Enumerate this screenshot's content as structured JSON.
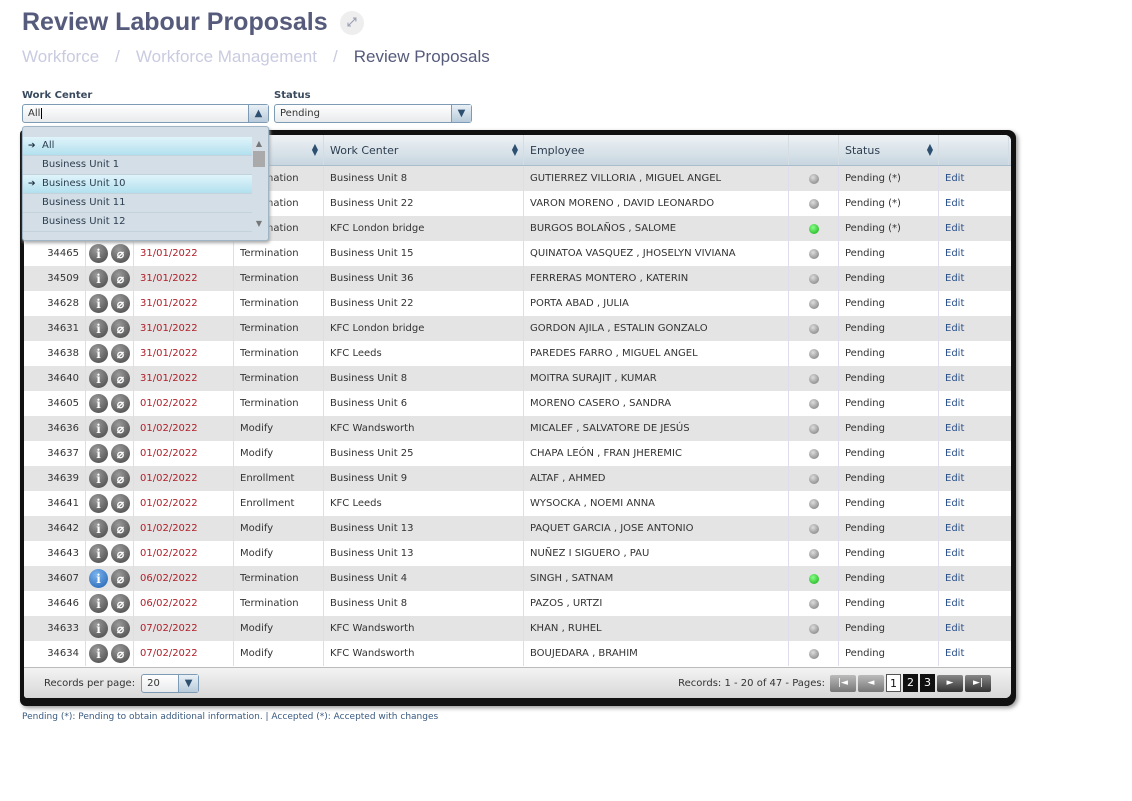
{
  "header": {
    "title": "Review Labour Proposals",
    "breadcrumb": [
      "Workforce",
      "Workforce Management",
      "Review Proposals"
    ]
  },
  "filters": {
    "work_center_label": "Work Center",
    "work_center_value": "All",
    "status_label": "Status",
    "status_value": "Pending"
  },
  "dropdown": {
    "options": [
      {
        "label": "All",
        "marker": true
      },
      {
        "label": "Business Unit 1",
        "marker": false
      },
      {
        "label": "Business Unit 10",
        "marker": true
      },
      {
        "label": "Business Unit 11",
        "marker": false
      },
      {
        "label": "Business Unit 12",
        "marker": false
      }
    ]
  },
  "table": {
    "columns": [
      "",
      "",
      "",
      "",
      "Work Center",
      "Employee",
      "",
      "Status",
      ""
    ],
    "rows": [
      {
        "id": "",
        "info": "gray",
        "date": "",
        "type": "Termination",
        "wc": "Business Unit 8",
        "emp": "GUTIERREZ VILLORIA , MIGUEL ANGEL",
        "dot": "gray",
        "status": "Pending (*)",
        "action": "Edit"
      },
      {
        "id": "",
        "info": "gray",
        "date": "",
        "type": "Termination",
        "wc": "Business Unit 22",
        "emp": "VARON MORENO , DAVID LEONARDO",
        "dot": "gray",
        "status": "Pending (*)",
        "action": "Edit"
      },
      {
        "id": "",
        "info": "gray",
        "date": "",
        "type": "Termination",
        "wc": "KFC London bridge",
        "emp": "BURGOS BOLAÑOS , SALOME",
        "dot": "green",
        "status": "Pending (*)",
        "action": "Edit"
      },
      {
        "id": "34465",
        "info": "gray",
        "date": "31/01/2022",
        "type": "Termination",
        "wc": "Business Unit 15",
        "emp": "QUINATOA VASQUEZ , JHOSELYN VIVIANA",
        "dot": "gray",
        "status": "Pending",
        "action": "Edit"
      },
      {
        "id": "34509",
        "info": "gray",
        "date": "31/01/2022",
        "type": "Termination",
        "wc": "Business Unit 36",
        "emp": "FERRERAS MONTERO , KATERIN",
        "dot": "gray",
        "status": "Pending",
        "action": "Edit"
      },
      {
        "id": "34628",
        "info": "gray",
        "date": "31/01/2022",
        "type": "Termination",
        "wc": "Business Unit 22",
        "emp": "PORTA ABAD , JULIA",
        "dot": "gray",
        "status": "Pending",
        "action": "Edit"
      },
      {
        "id": "34631",
        "info": "gray",
        "date": "31/01/2022",
        "type": "Termination",
        "wc": "KFC London bridge",
        "emp": "GORDON AJILA , ESTALIN GONZALO",
        "dot": "gray",
        "status": "Pending",
        "action": "Edit"
      },
      {
        "id": "34638",
        "info": "gray",
        "date": "31/01/2022",
        "type": "Termination",
        "wc": "KFC Leeds",
        "emp": "PAREDES FARRO , MIGUEL ANGEL",
        "dot": "gray",
        "status": "Pending",
        "action": "Edit"
      },
      {
        "id": "34640",
        "info": "gray",
        "date": "31/01/2022",
        "type": "Termination",
        "wc": "Business Unit 8",
        "emp": "MOITRA SURAJIT , KUMAR",
        "dot": "gray",
        "status": "Pending",
        "action": "Edit"
      },
      {
        "id": "34605",
        "info": "gray",
        "date": "01/02/2022",
        "type": "Termination",
        "wc": "Business Unit 6",
        "emp": "MORENO CASERO , SANDRA",
        "dot": "gray",
        "status": "Pending",
        "action": "Edit"
      },
      {
        "id": "34636",
        "info": "gray",
        "date": "01/02/2022",
        "type": "Modify",
        "wc": "KFC Wandsworth",
        "emp": "MICALEF , SALVATORE DE JESÚS",
        "dot": "gray",
        "status": "Pending",
        "action": "Edit"
      },
      {
        "id": "34637",
        "info": "gray",
        "date": "01/02/2022",
        "type": "Modify",
        "wc": "Business Unit 25",
        "emp": "CHAPA LEÓN , FRAN JHEREMIC",
        "dot": "gray",
        "status": "Pending",
        "action": "Edit"
      },
      {
        "id": "34639",
        "info": "gray",
        "date": "01/02/2022",
        "type": "Enrollment",
        "wc": "Business Unit 9",
        "emp": "ALTAF , AHMED",
        "dot": "gray",
        "status": "Pending",
        "action": "Edit"
      },
      {
        "id": "34641",
        "info": "gray",
        "date": "01/02/2022",
        "type": "Enrollment",
        "wc": "KFC Leeds",
        "emp": "WYSOCKA , NOEMI ANNA",
        "dot": "gray",
        "status": "Pending",
        "action": "Edit"
      },
      {
        "id": "34642",
        "info": "gray",
        "date": "01/02/2022",
        "type": "Modify",
        "wc": "Business Unit 13",
        "emp": "PAQUET GARCIA , JOSE ANTONIO",
        "dot": "gray",
        "status": "Pending",
        "action": "Edit"
      },
      {
        "id": "34643",
        "info": "gray",
        "date": "01/02/2022",
        "type": "Modify",
        "wc": "Business Unit 13",
        "emp": "NUÑEZ I SIGUERO , PAU",
        "dot": "gray",
        "status": "Pending",
        "action": "Edit"
      },
      {
        "id": "34607",
        "info": "blue",
        "date": "06/02/2022",
        "type": "Termination",
        "wc": "Business Unit 4",
        "emp": "SINGH , SATNAM",
        "dot": "green",
        "status": "Pending",
        "action": "Edit"
      },
      {
        "id": "34646",
        "info": "gray",
        "date": "06/02/2022",
        "type": "Termination",
        "wc": "Business Unit 8",
        "emp": "PAZOS , URTZI",
        "dot": "gray",
        "status": "Pending",
        "action": "Edit"
      },
      {
        "id": "34633",
        "info": "gray",
        "date": "07/02/2022",
        "type": "Modify",
        "wc": "KFC Wandsworth",
        "emp": "KHAN , RUHEL",
        "dot": "gray",
        "status": "Pending",
        "action": "Edit"
      },
      {
        "id": "34634",
        "info": "gray",
        "date": "07/02/2022",
        "type": "Modify",
        "wc": "KFC Wandsworth",
        "emp": "BOUJEDARA , BRAHIM",
        "dot": "gray",
        "status": "Pending",
        "action": "Edit"
      }
    ]
  },
  "footer": {
    "records_per_page_label": "Records per page:",
    "records_per_page": "20",
    "records_text": "Records: 1 - 20 of 47 - Pages:",
    "pages": [
      "1",
      "2",
      "3"
    ],
    "current_page": "1"
  },
  "legend_note": "Pending (*): Pending to obtain additional information.  |  Accepted (*): Accepted with changes",
  "colors": {
    "title": "#565b7c",
    "date": "#b0202a",
    "row_alt": "#e4e4e4",
    "dropdown_selected": "#b2e0ee"
  }
}
